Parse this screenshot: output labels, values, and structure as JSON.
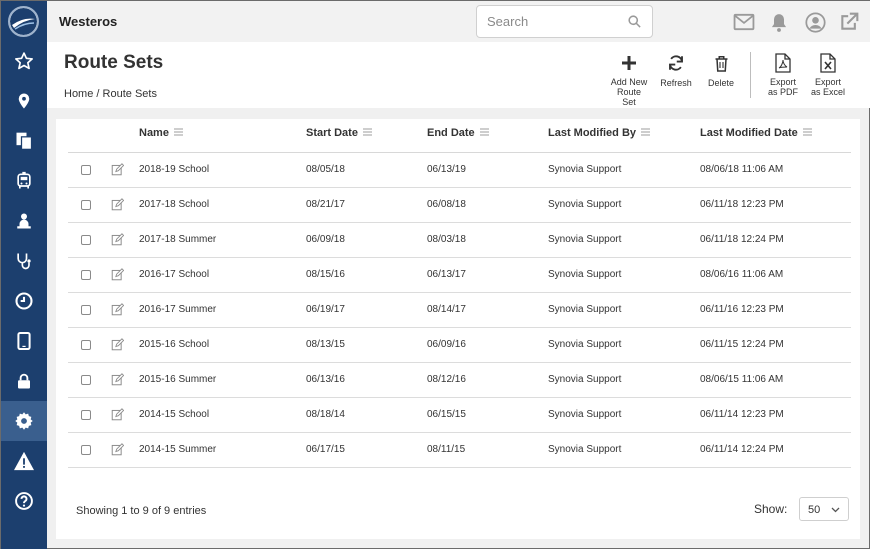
{
  "app": {
    "title": "Westeros"
  },
  "search": {
    "placeholder": "Search",
    "value": ""
  },
  "header_icons": [
    "mail-icon",
    "bell-icon",
    "user-icon",
    "external-link-icon"
  ],
  "sidebar": {
    "items": [
      {
        "icon": "star-icon"
      },
      {
        "icon": "map-pin-icon"
      },
      {
        "icon": "copy-documents-icon"
      },
      {
        "icon": "bus-icon"
      },
      {
        "icon": "student-icon"
      },
      {
        "icon": "stethoscope-icon"
      },
      {
        "icon": "clock-icon"
      },
      {
        "icon": "tablet-icon"
      },
      {
        "icon": "lock-icon"
      },
      {
        "icon": "gear-icon",
        "active": true
      },
      {
        "icon": "warning-icon"
      },
      {
        "icon": "help-icon"
      }
    ]
  },
  "page": {
    "title": "Route Sets",
    "breadcrumb_home": "Home",
    "breadcrumb_sep": "/",
    "breadcrumb_current": "Route Sets"
  },
  "toolbar": {
    "add_line1": "Add New",
    "add_line2": "Route Set",
    "refresh": "Refresh",
    "delete": "Delete",
    "pdf_line1": "Export",
    "pdf_line2": "as PDF",
    "excel_line1": "Export",
    "excel_line2": "as Excel"
  },
  "table": {
    "columns": {
      "name": "Name",
      "start": "Start Date",
      "end": "End Date",
      "modified_by": "Last Modified By",
      "modified_date": "Last Modified Date"
    },
    "rows": [
      {
        "name": "2018-19 School",
        "start": "08/05/18",
        "end": "06/13/19",
        "by": "Synovia Support",
        "date": "08/06/18 11:06 AM"
      },
      {
        "name": "2017-18 School",
        "start": "08/21/17",
        "end": "06/08/18",
        "by": "Synovia Support",
        "date": "06/11/18 12:23 PM"
      },
      {
        "name": "2017-18 Summer",
        "start": "06/09/18",
        "end": "08/03/18",
        "by": "Synovia Support",
        "date": "06/11/18 12:24 PM"
      },
      {
        "name": "2016-17 School",
        "start": "08/15/16",
        "end": "06/13/17",
        "by": "Synovia Support",
        "date": "08/06/16 11:06 AM"
      },
      {
        "name": "2016-17 Summer",
        "start": "06/19/17",
        "end": "08/14/17",
        "by": "Synovia Support",
        "date": "06/11/16 12:23 PM"
      },
      {
        "name": "2015-16 School",
        "start": "08/13/15",
        "end": "06/09/16",
        "by": "Synovia Support",
        "date": "06/11/15 12:24 PM"
      },
      {
        "name": "2015-16 Summer",
        "start": "06/13/16",
        "end": "08/12/16",
        "by": "Synovia Support",
        "date": "08/06/15 11:06 AM"
      },
      {
        "name": "2014-15 School",
        "start": "08/18/14",
        "end": "06/15/15",
        "by": "Synovia Support",
        "date": "06/11/14 12:23 PM"
      },
      {
        "name": "2014-15 Summer",
        "start": "06/17/15",
        "end": "08/11/15",
        "by": "Synovia Support",
        "date": "06/11/14 12:24 PM"
      }
    ]
  },
  "footer": {
    "info": "Showing 1 to 9 of 9 entries",
    "show_label": "Show:",
    "page_size": "50"
  }
}
